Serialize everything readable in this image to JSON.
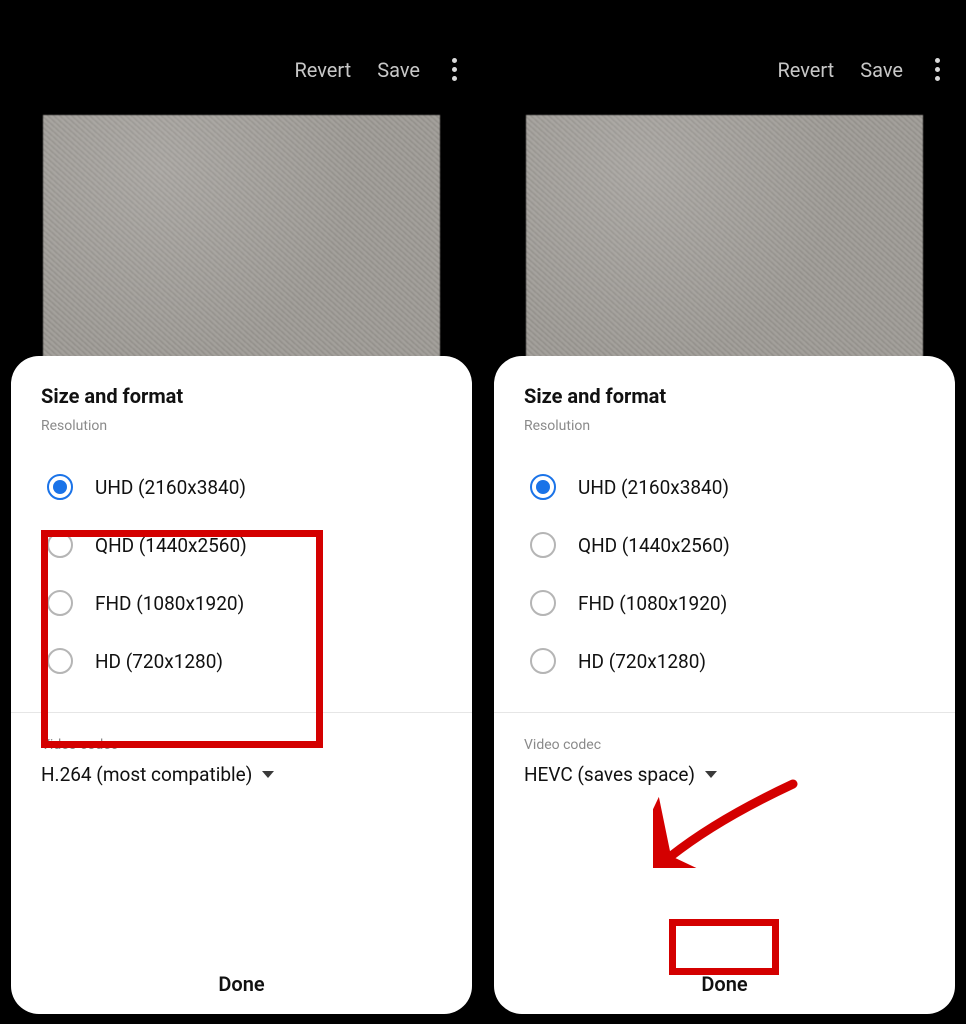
{
  "header": {
    "revert": "Revert",
    "save": "Save"
  },
  "sheet": {
    "title": "Size and format",
    "resolution_label": "Resolution",
    "options": [
      {
        "label": "UHD (2160x3840)",
        "selected": true
      },
      {
        "label": "QHD (1440x2560)",
        "selected": false
      },
      {
        "label": "FHD (1080x1920)",
        "selected": false
      },
      {
        "label": "HD (720x1280)",
        "selected": false
      }
    ],
    "codec_label": "Video codec",
    "done": "Done"
  },
  "panes": {
    "left": {
      "codec_value": "H.264 (most compatible)"
    },
    "right": {
      "codec_value": "HEVC (saves space)"
    }
  }
}
